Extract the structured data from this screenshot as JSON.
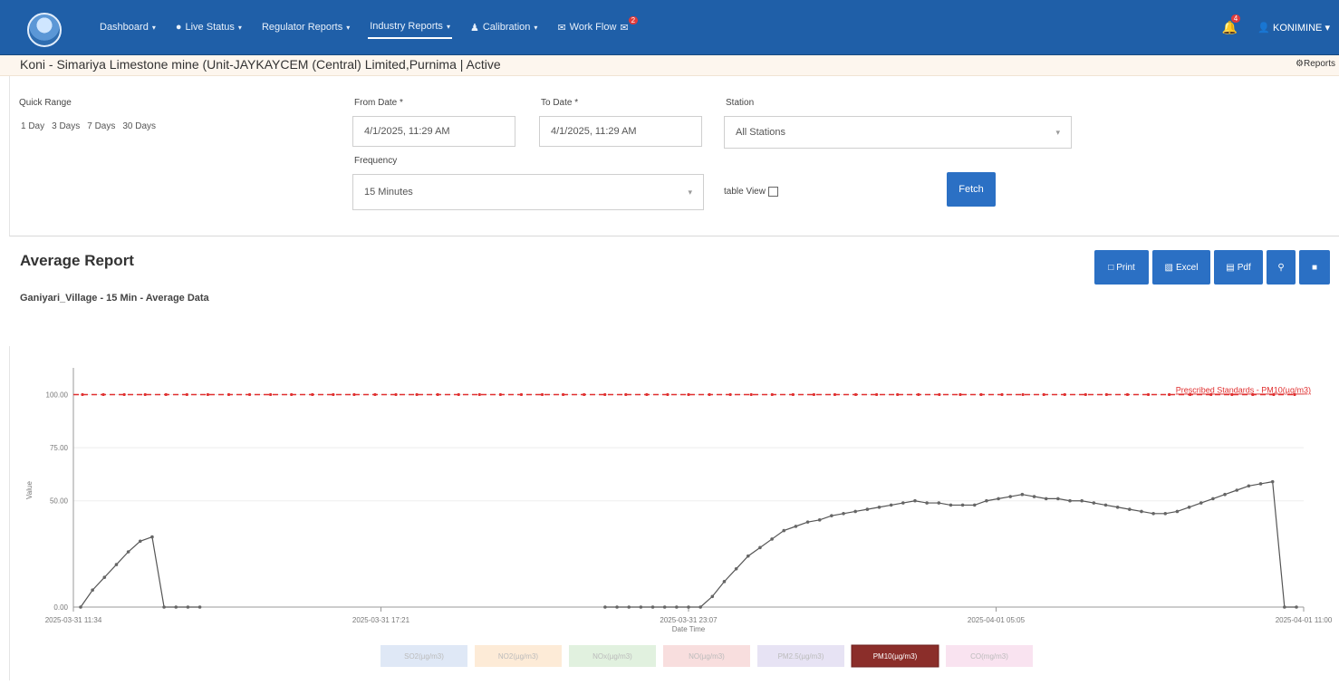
{
  "nav": {
    "items": [
      {
        "label": "Dashboard",
        "icon": "",
        "has_caret": true
      },
      {
        "label": "Live Status",
        "icon": "live-dot-icon",
        "has_caret": true
      },
      {
        "label": "Regulator Reports",
        "icon": "",
        "has_caret": true
      },
      {
        "label": "Industry Reports",
        "icon": "",
        "has_caret": true
      },
      {
        "label": "Calibration",
        "icon": "user-icon",
        "has_caret": true
      },
      {
        "label": "Work Flow",
        "icon": "mail-icon",
        "has_caret": false,
        "badge": "2"
      }
    ],
    "active_index": 3,
    "notification_badge": "4",
    "user_label": "KONIMINE"
  },
  "page": {
    "title": "Koni - Simariya Limestone mine (Unit-JAYKAYCEM (Central) Limited,Purnima | Active",
    "reports_link": "Reports"
  },
  "filters": {
    "quick_range_label": "Quick Range",
    "quick_ranges": [
      "1 Day",
      "3 Days",
      "7 Days",
      "30 Days"
    ],
    "from_label": "From Date *",
    "from_value": "4/1/2025, 11:29 AM",
    "to_label": "To Date *",
    "to_value": "4/1/2025, 11:29 AM",
    "station_label": "Station",
    "station_value": "All Stations",
    "frequency_label": "Frequency",
    "frequency_value": "15 Minutes",
    "table_view_label": "table View",
    "fetch_label": "Fetch"
  },
  "report": {
    "title": "Average Report",
    "subtitle": "Ganiyari_Village - 15 Min - Average Data",
    "actions": [
      "Print",
      "Excel",
      "Pdf"
    ]
  },
  "colors": {
    "navbar": "#1f5fa8",
    "primary_button": "#2b70c4",
    "series_line": "#555555",
    "threshold": "#e03030",
    "active_legend": "#8b2e2a"
  },
  "chart_data": {
    "type": "line",
    "y_ticks": [
      "0.00",
      "50.00",
      "75.00",
      "100.00"
    ],
    "x_ticks": [
      "2025-03-31 11:34",
      "2025-03-31 17:21",
      "2025-03-31 23:07",
      "2025-04-01 05:05",
      "2025-04-01 11:00"
    ],
    "xlabel": "Date Time",
    "ylabel": "Value",
    "ylim": [
      0,
      110
    ],
    "threshold": {
      "value": 100,
      "label": "Prescribed Standards - PM10(µg/m3)"
    },
    "series": [
      {
        "name": "PM10(µg/m3)",
        "values": [
          0,
          8,
          14,
          20,
          26,
          31,
          33,
          0,
          0,
          0,
          0,
          null,
          null,
          null,
          null,
          null,
          null,
          null,
          null,
          null,
          null,
          null,
          null,
          null,
          null,
          null,
          null,
          null,
          null,
          null,
          null,
          null,
          null,
          null,
          null,
          null,
          null,
          null,
          null,
          null,
          null,
          null,
          null,
          null,
          0,
          0,
          0,
          0,
          0,
          0,
          0,
          0,
          0,
          5,
          12,
          18,
          24,
          28,
          32,
          36,
          38,
          40,
          41,
          43,
          44,
          45,
          46,
          47,
          48,
          49,
          50,
          49,
          49,
          48,
          48,
          48,
          50,
          51,
          52,
          53,
          52,
          51,
          51,
          50,
          50,
          49,
          48,
          47,
          46,
          45,
          44,
          44,
          45,
          47,
          49,
          51,
          53,
          55,
          57,
          58,
          59,
          0,
          0
        ]
      }
    ],
    "legend": [
      "SO2(µg/m3)",
      "NO2(µg/m3)",
      "NOx(µg/m3)",
      "NO(µg/m3)",
      "PM2.5(µg/m3)",
      "PM10(µg/m3)",
      "CO(mg/m3)"
    ],
    "legend_colors": [
      "#dfe8f6",
      "#fdebd7",
      "#e1f1df",
      "#f8dede",
      "#e7e3f4",
      "#8b2e2a",
      "#f9e3f0"
    ],
    "legend_active": 5,
    "legend_position": "bottom",
    "grid": true
  }
}
